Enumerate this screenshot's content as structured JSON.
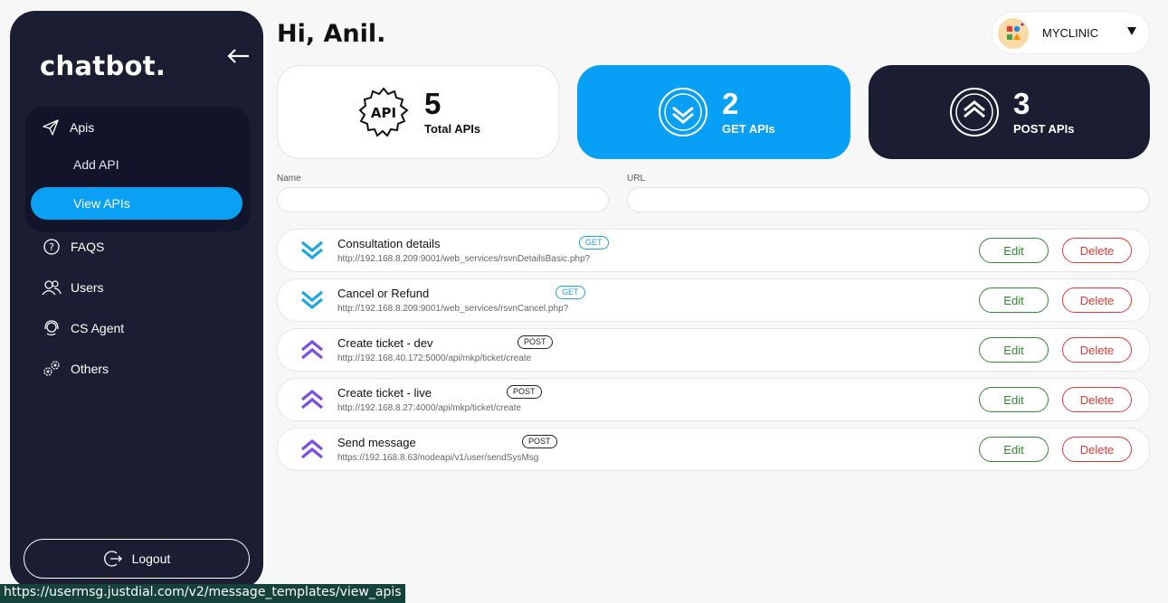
{
  "sidebar": {
    "brand": "chatbot.",
    "nav": {
      "apis": "Apis",
      "add_api": "Add API",
      "view_apis": "View APIs",
      "faqs": "FAQS",
      "users": "Users",
      "cs_agent": "CS Agent",
      "others": "Others"
    },
    "logout": "Logout"
  },
  "header": {
    "greeting": "Hi, Anil.",
    "clinic": "MYCLINIC"
  },
  "stats": {
    "total": {
      "value": "5",
      "label": "Total APIs"
    },
    "get": {
      "value": "2",
      "label": "GET APIs"
    },
    "post": {
      "value": "3",
      "label": "POST APIs"
    }
  },
  "filters": {
    "name_label": "Name",
    "url_label": "URL",
    "name_value": "",
    "url_value": ""
  },
  "apis": [
    {
      "name": "Consultation details",
      "url": "http://192.168.8.209:9001/web_services/rsvnDetailsBasic.php?",
      "method": "GET"
    },
    {
      "name": "Cancel or Refund",
      "url": "http://192.168.8.209:9001/web_services/rsvnCancel.php?",
      "method": "GET"
    },
    {
      "name": "Create ticket - dev",
      "url": "http://192.168.40.172:5000/api/mkp/ticket/create",
      "method": "POST"
    },
    {
      "name": "Create ticket - live",
      "url": "http://192.168.8.27:4000/api/mkp/ticket/create",
      "method": "POST"
    },
    {
      "name": "Send message",
      "url": "https://192.168.8.63/nodeapi/v1/user/sendSysMsg",
      "method": "POST"
    }
  ],
  "actions": {
    "edit": "Edit",
    "delete": "Delete"
  },
  "status_url": "https://usermsg.justdial.com/v2/message_templates/view_apis",
  "colors": {
    "accent": "#08a0f7",
    "dark": "#1b1e32",
    "edit": "#2e8b2e",
    "delete": "#e53935",
    "get_icon": "#1ea7e0",
    "post_icon": "#7b4fe0"
  }
}
